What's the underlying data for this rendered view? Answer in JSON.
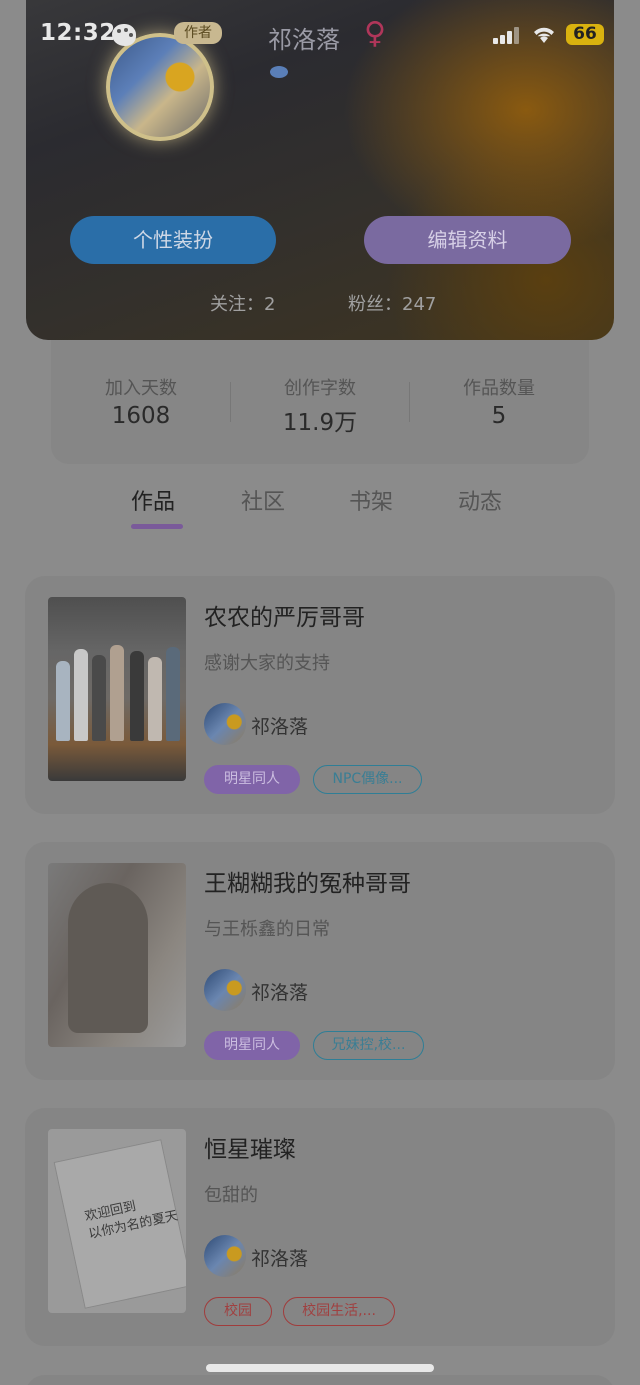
{
  "status_bar": {
    "time": "12:32",
    "battery": "66"
  },
  "profile": {
    "author_tag": "作者",
    "username": "祁洛落",
    "gender_symbol": "♀",
    "dress_button": "个性装扮",
    "edit_button": "编辑资料",
    "following_label": "关注：",
    "following_count": "2",
    "fans_label": "粉丝：",
    "fans_count": "247"
  },
  "stats": [
    {
      "label": "加入天数",
      "value": "1608"
    },
    {
      "label": "创作字数",
      "value": "11.9万"
    },
    {
      "label": "作品数量",
      "value": "5"
    }
  ],
  "tabs": [
    {
      "label": "作品",
      "active": true
    },
    {
      "label": "社区",
      "active": false
    },
    {
      "label": "书架",
      "active": false
    },
    {
      "label": "动态",
      "active": false
    }
  ],
  "works": [
    {
      "title": "农农的严厉哥哥",
      "desc": "感谢大家的支持",
      "author": "祁洛落",
      "tags": [
        "明星同人",
        "NPC偶像..."
      ]
    },
    {
      "title": "王糊糊我的冤种哥哥",
      "desc": "与王栎鑫的日常",
      "author": "祁洛落",
      "tags": [
        "明星同人",
        "兄妹控,校..."
      ]
    },
    {
      "title": "恒星璀璨",
      "desc": "包甜的",
      "author": "祁洛落",
      "tags": [
        "校园",
        "校园生活,..."
      ],
      "cover_text": [
        "欢迎回到",
        "以你为名的夏天"
      ]
    }
  ],
  "colors": {
    "accent_purple": "#7a5a9a",
    "dress_button": "#2a6ea8",
    "edit_button": "#7a6aa0"
  }
}
